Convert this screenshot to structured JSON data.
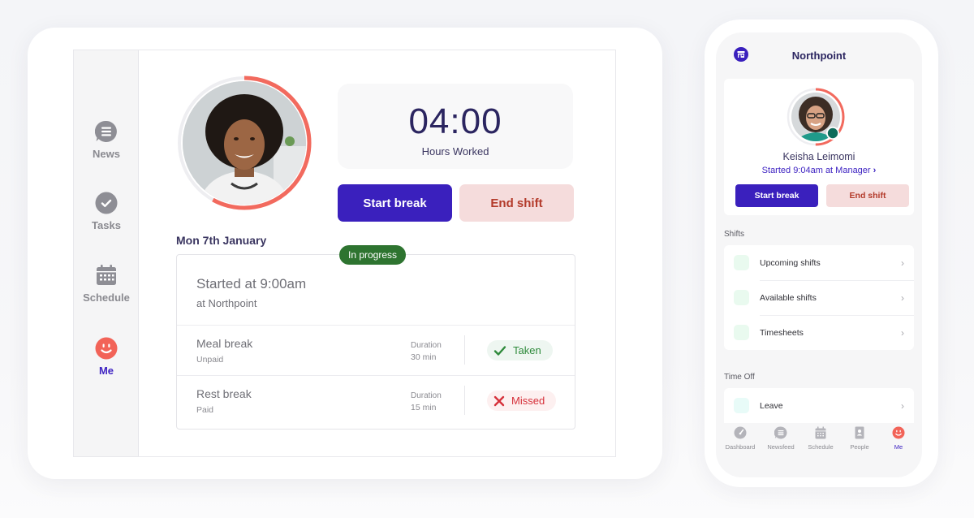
{
  "colors": {
    "brand": "#3a20bd",
    "accent_ring": "#f26a5e",
    "in_progress": "#2e7430",
    "taken": "#2e8a3b",
    "missed": "#d6303a",
    "end_shift_bg": "#f5dcdc"
  },
  "tablet": {
    "sidebar": {
      "items": [
        {
          "label": "News",
          "icon": "news-chat-icon",
          "active": false
        },
        {
          "label": "Tasks",
          "icon": "check-circle-icon",
          "active": false
        },
        {
          "label": "Schedule",
          "icon": "calendar-icon",
          "active": false
        },
        {
          "label": "Me",
          "icon": "smiley-icon",
          "active": true
        }
      ]
    },
    "avatar": {
      "progress_fraction": 0.58
    },
    "hours": {
      "value": "04:00",
      "label": "Hours Worked"
    },
    "actions": {
      "start_break": "Start break",
      "end_shift": "End shift"
    },
    "date_heading": "Mon 7th January",
    "shift": {
      "status": "In progress",
      "started": "Started at 9:00am",
      "location": "at Northpoint",
      "duration_label": "Duration",
      "breaks": [
        {
          "name": "Meal break",
          "pay": "Unpaid",
          "duration": "30 min",
          "status": "Taken",
          "status_icon": "check-icon"
        },
        {
          "name": "Rest break",
          "pay": "Paid",
          "duration": "15 min",
          "status": "Missed",
          "status_icon": "x-icon"
        }
      ]
    }
  },
  "phone": {
    "title": "Northpoint",
    "store_icon": "store-icon",
    "profile": {
      "name": "Keisha Leimomi",
      "started": "Started 9:04am at Manager",
      "progress_fraction": 0.5,
      "online": true
    },
    "actions": {
      "start_break": "Start break",
      "end_shift": "End shift"
    },
    "sections": [
      {
        "label": "Shifts",
        "items": [
          "Upcoming shifts",
          "Available shifts",
          "Timesheets"
        ]
      },
      {
        "label": "Time Off",
        "items": [
          "Leave"
        ]
      }
    ],
    "tabbar": [
      {
        "label": "Dashboard",
        "icon": "dashboard-gauge-icon",
        "active": false
      },
      {
        "label": "Newsfeed",
        "icon": "news-chat-icon",
        "active": false
      },
      {
        "label": "Schedule",
        "icon": "calendar-icon",
        "active": false
      },
      {
        "label": "People",
        "icon": "contact-book-icon",
        "active": false
      },
      {
        "label": "Me",
        "icon": "smiley-icon",
        "active": true
      }
    ]
  }
}
